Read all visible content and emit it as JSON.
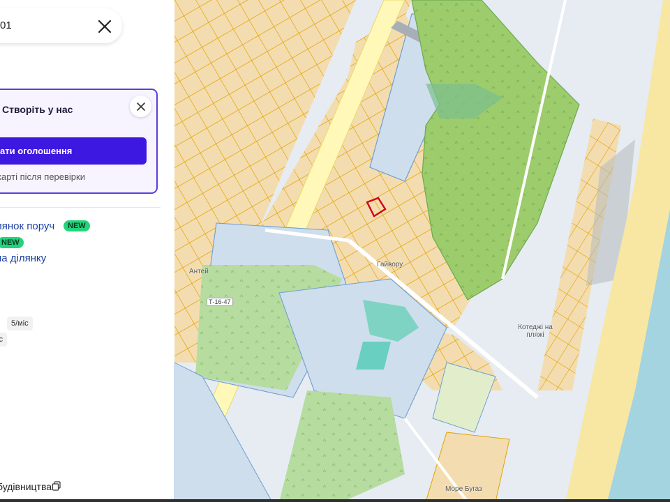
{
  "search": {
    "value": "01"
  },
  "promo": {
    "title": "Створіть у нас",
    "button_label": "ати оголошення",
    "note": "на карті після перевірки"
  },
  "links": {
    "plot_nearby": "лянок поруч",
    "plot_nearby_badge": "NEW",
    "second_badge": "NEW",
    "plot_link": "на ділянку"
  },
  "chips": {
    "chip1": "5/міс",
    "chip2": "іс"
  },
  "footer": {
    "label": "будівництва"
  },
  "map": {
    "labels": {
      "antey": "Антей",
      "road": "Т-16-47",
      "gaivoron": "Гайвору",
      "cottages": "Котеджі на пляжі",
      "more": "Море Бугаз"
    },
    "colors": {
      "parcel_fill": "#f3ddb0",
      "parcel_stroke": "#e3a100",
      "green_zone": "#9ccc6c",
      "water": "#a3d4e0",
      "beach": "#f7e7a3",
      "road": "#ffffff",
      "highlight": "#d4001a"
    }
  }
}
